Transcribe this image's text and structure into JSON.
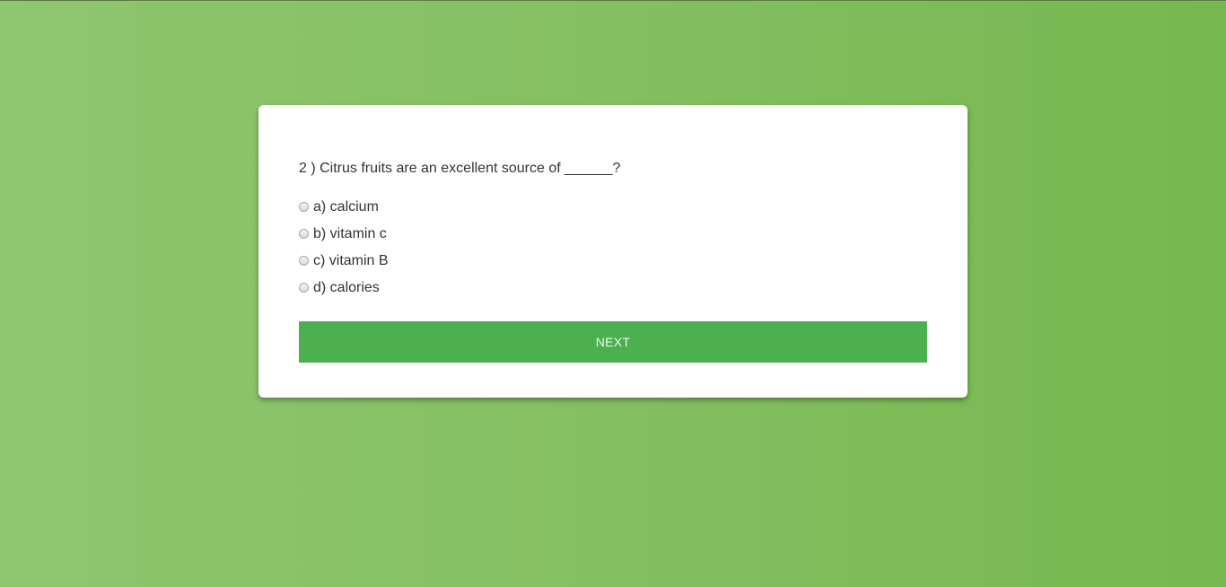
{
  "quiz": {
    "question": "2 ) Citrus fruits are an excellent source of ______?",
    "options": [
      {
        "label": "a) calcium",
        "selected": false
      },
      {
        "label": "b) vitamin c",
        "selected": false
      },
      {
        "label": "c) vitamin B",
        "selected": false
      },
      {
        "label": "d) calories",
        "selected": false
      }
    ],
    "next_label": "NEXT"
  },
  "colors": {
    "background_left": "#8fc670",
    "background_right": "#76b84e",
    "card": "#ffffff",
    "button": "#4caf50",
    "text": "#333333"
  }
}
